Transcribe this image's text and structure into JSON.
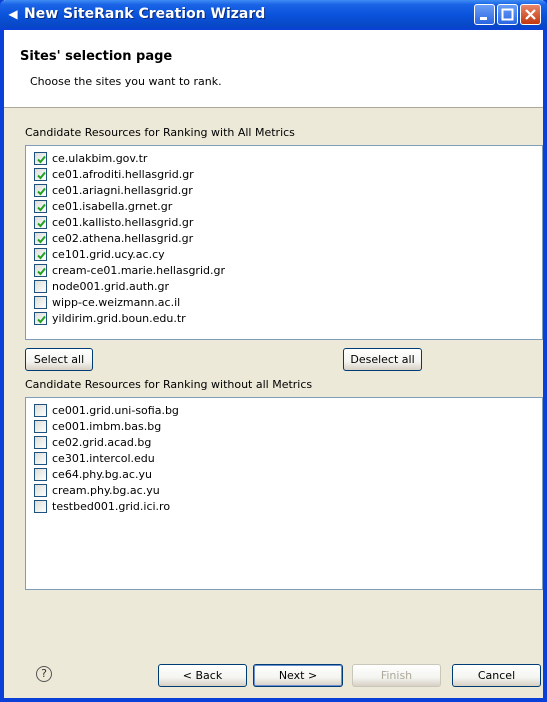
{
  "window": {
    "title": "New SiteRank Creation Wizard",
    "icon": "arrow-left-icon"
  },
  "header": {
    "title": "Sites' selection page",
    "description": "Choose the sites you want to rank."
  },
  "all_metrics": {
    "label": "Candidate Resources for Ranking with All Metrics",
    "items": [
      {
        "label": "ce.ulakbim.gov.tr",
        "checked": true
      },
      {
        "label": "ce01.afroditi.hellasgrid.gr",
        "checked": true
      },
      {
        "label": "ce01.ariagni.hellasgrid.gr",
        "checked": true
      },
      {
        "label": "ce01.isabella.grnet.gr",
        "checked": true
      },
      {
        "label": "ce01.kallisto.hellasgrid.gr",
        "checked": true
      },
      {
        "label": "ce02.athena.hellasgrid.gr",
        "checked": true
      },
      {
        "label": "ce101.grid.ucy.ac.cy",
        "checked": true
      },
      {
        "label": "cream-ce01.marie.hellasgrid.gr",
        "checked": true
      },
      {
        "label": "node001.grid.auth.gr",
        "checked": false
      },
      {
        "label": "wipp-ce.weizmann.ac.il",
        "checked": false
      },
      {
        "label": "yildirim.grid.boun.edu.tr",
        "checked": true
      }
    ],
    "select_all_label": "Select all",
    "deselect_all_label": "Deselect all"
  },
  "without_metrics": {
    "label": "Candidate Resources for Ranking without all  Metrics",
    "items": [
      {
        "label": "ce001.grid.uni-sofia.bg",
        "checked": false
      },
      {
        "label": "ce001.imbm.bas.bg",
        "checked": false
      },
      {
        "label": "ce02.grid.acad.bg",
        "checked": false
      },
      {
        "label": "ce301.intercol.edu",
        "checked": false
      },
      {
        "label": "ce64.phy.bg.ac.yu",
        "checked": false
      },
      {
        "label": "cream.phy.bg.ac.yu",
        "checked": false
      },
      {
        "label": "testbed001.grid.ici.ro",
        "checked": false
      }
    ]
  },
  "footer": {
    "help_icon": "help-icon",
    "help_glyph": "?",
    "back_label": "< Back",
    "next_label": "Next >",
    "finish_label": "Finish",
    "cancel_label": "Cancel"
  },
  "colors": {
    "titlebar": "#0a53dc",
    "dialog_bg": "#ece9d8",
    "check": "#21a121"
  }
}
